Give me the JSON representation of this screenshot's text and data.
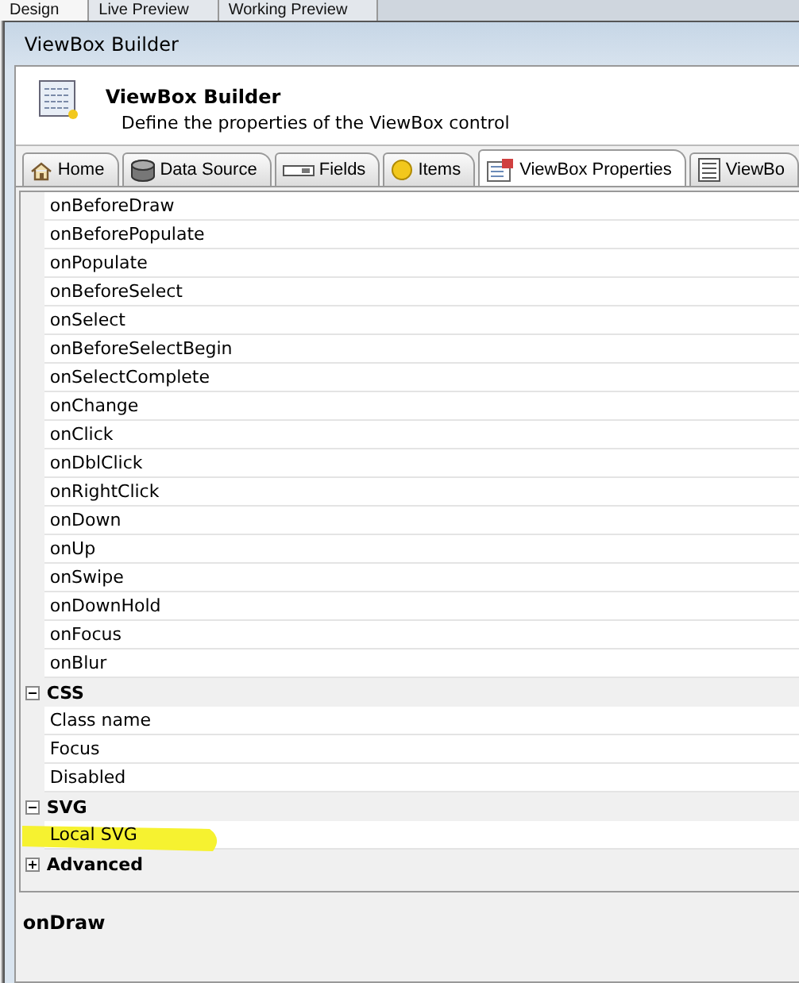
{
  "background_tabs": [
    {
      "label": "Design",
      "selected": true
    },
    {
      "label": "Live Preview",
      "selected": false
    },
    {
      "label": "Working Preview",
      "selected": false
    }
  ],
  "window": {
    "title": "ViewBox Builder"
  },
  "header": {
    "title": "ViewBox Builder",
    "subtitle": "Define the properties of the ViewBox control"
  },
  "tabs": [
    {
      "label": "Home",
      "selected": false
    },
    {
      "label": "Data Source",
      "selected": false
    },
    {
      "label": "Fields",
      "selected": false
    },
    {
      "label": "Items",
      "selected": false
    },
    {
      "label": "ViewBox Properties",
      "selected": true
    },
    {
      "label": "ViewBo",
      "selected": false
    }
  ],
  "property_grid": {
    "categories": [
      {
        "properties": [
          {
            "name": "onBeforeDraw"
          },
          {
            "name": "onBeforePopulate"
          },
          {
            "name": "onPopulate"
          },
          {
            "name": "onBeforeSelect"
          },
          {
            "name": "onSelect"
          },
          {
            "name": "onBeforeSelectBegin"
          },
          {
            "name": "onSelectComplete"
          },
          {
            "name": "onChange"
          },
          {
            "name": "onClick"
          },
          {
            "name": "onDblClick"
          },
          {
            "name": "onRightClick"
          },
          {
            "name": "onDown"
          },
          {
            "name": "onUp"
          },
          {
            "name": "onSwipe"
          },
          {
            "name": "onDownHold"
          },
          {
            "name": "onFocus"
          },
          {
            "name": "onBlur"
          }
        ]
      },
      {
        "name": "CSS",
        "expanded": true,
        "properties": [
          {
            "name": "Class name"
          },
          {
            "name": "Focus"
          },
          {
            "name": "Disabled"
          }
        ]
      },
      {
        "name": "SVG",
        "expanded": true,
        "properties": [
          {
            "name": "Local SVG",
            "highlighted": true
          }
        ]
      },
      {
        "name": "Advanced",
        "expanded": false
      }
    ]
  },
  "description": {
    "title": "onDraw"
  }
}
